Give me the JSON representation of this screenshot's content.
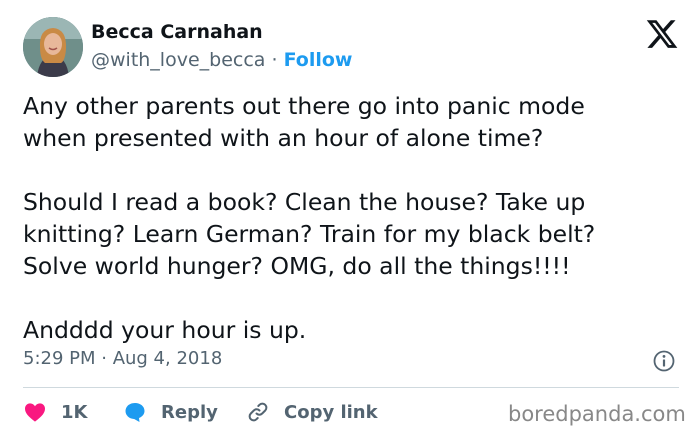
{
  "author": {
    "name": "Becca Carnahan",
    "handle": "@with_love_becca",
    "separator": "·",
    "follow_label": "Follow",
    "avatar_icon": "avatar-photo"
  },
  "platform": {
    "logo_icon": "x-logo-icon"
  },
  "tweet": {
    "lines": [
      "Any other parents out there go into panic mode",
      "when presented with an hour of alone time?",
      "",
      "Should I read a book? Clean the house? Take up",
      "knitting? Learn German? Train for my black belt?",
      "Solve world hunger? OMG, do all the things!!!!",
      "",
      "Andddd your hour is up."
    ],
    "timestamp": "5:29 PM · Aug 4, 2018",
    "info_icon": "info-icon"
  },
  "actions": {
    "likes_count": "1K",
    "like_icon": "heart-icon",
    "reply_label": "Reply",
    "reply_icon": "speech-bubble-icon",
    "copy_label": "Copy link",
    "copy_icon": "link-icon"
  },
  "watermark": "boredpanda.com",
  "colors": {
    "text": "#0f1419",
    "secondary": "#536471",
    "accent": "#1d9bf0",
    "like": "#f91880",
    "divider": "#cfd9de"
  }
}
